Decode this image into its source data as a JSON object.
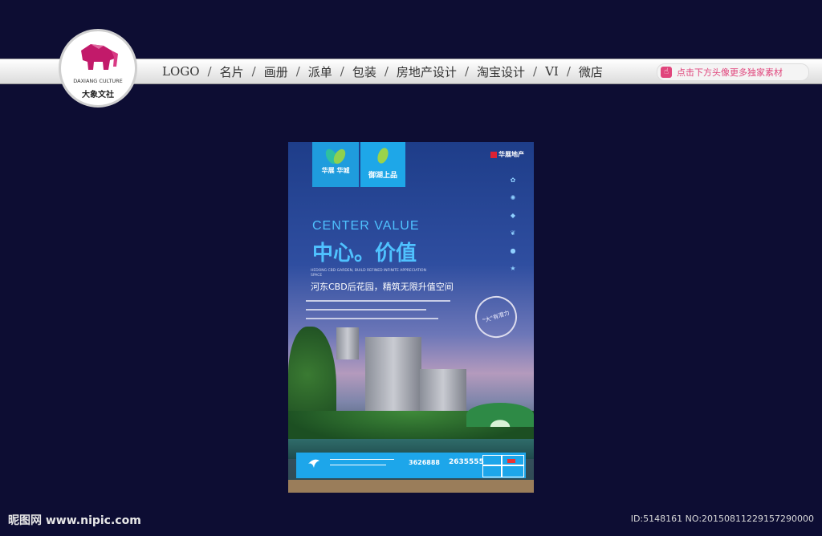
{
  "logo": {
    "name_en": "DAXIANG CULTURE",
    "name_cn": "大象文社"
  },
  "nav": {
    "items": [
      "LOGO",
      "名片",
      "画册",
      "派单",
      "包装",
      "房地产设计",
      "淘宝设计",
      "VI",
      "微店"
    ],
    "separator": "/"
  },
  "promo": {
    "label": "点击下方头像更多独家素材"
  },
  "poster": {
    "tab1_title": "华展 华城",
    "tab2_title": "御湖上品",
    "brand": "华展地产",
    "headline_en": "CENTER VALUE",
    "headline_cn": "中心。价值",
    "sub_en": "HEDONG CBD GARDEN, BUILD REFINED INFINITE APPRECIATION SPACE",
    "sub_cn": "河东CBD后花园，精筑无限升值空间",
    "stamp": "\"大\"有潜力",
    "footer": {
      "phone1": "3626888",
      "phone2": "2635555"
    }
  },
  "watermark": {
    "site": "昵图网 www.nipic.com",
    "id": "ID:5148161 NO:20150811229157290000"
  },
  "colors": {
    "background": "#0d0d33",
    "accent": "#1da6ea",
    "pink": "#e0457c"
  }
}
